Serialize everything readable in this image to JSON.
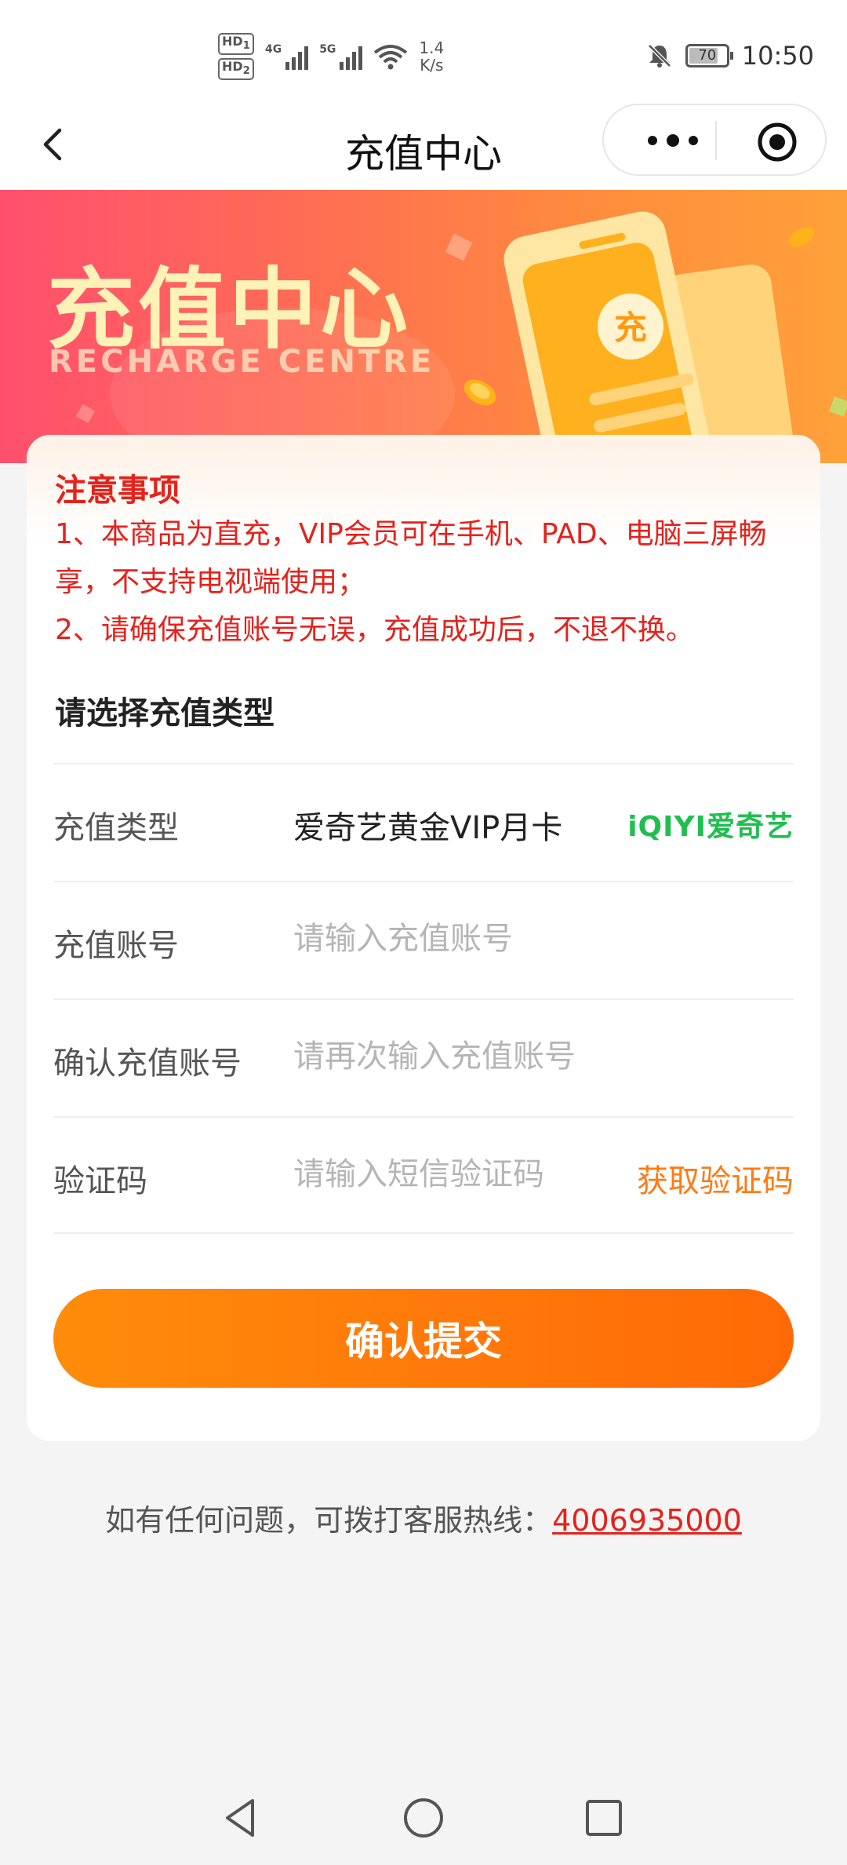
{
  "status_bar": {
    "hd1": "HD",
    "hd2": "HD",
    "sim1": "1",
    "sim2": "2",
    "net1": "4G",
    "net2": "5G",
    "speed_value": "1.4",
    "speed_unit": "K/s",
    "battery": "70",
    "time": "10:50"
  },
  "nav": {
    "title": "充值中心"
  },
  "banner": {
    "title": "充值中心",
    "subtitle": "RECHARGE CENTRE",
    "badge_char": "充"
  },
  "notice": {
    "title": "注意事项",
    "line1": "1、本商品为直充，VIP会员可在手机、PAD、电脑三屏畅享，不支持电视端使用；",
    "line2": "2、请确保充值账号无误，充值成功后，不退不换。"
  },
  "form": {
    "section_title": "请选择充值类型",
    "type_label": "充值类型",
    "type_value": "爱奇艺黄金VIP月卡",
    "type_logo": "iQIYI爱奇艺",
    "account_label": "充值账号",
    "account_placeholder": "请输入充值账号",
    "confirm_label": "确认充值账号",
    "confirm_placeholder": "请再次输入充值账号",
    "code_label": "验证码",
    "code_placeholder": "请输入短信验证码",
    "get_code": "获取验证码",
    "submit": "确认提交"
  },
  "footer": {
    "hotline_text": "如有任何问题，可拨打客服热线：",
    "hotline_number": "4006935000"
  },
  "colors": {
    "accent_orange": "#ff7a0a",
    "notice_red": "#e4221c",
    "logo_green": "#1fbf4e"
  }
}
